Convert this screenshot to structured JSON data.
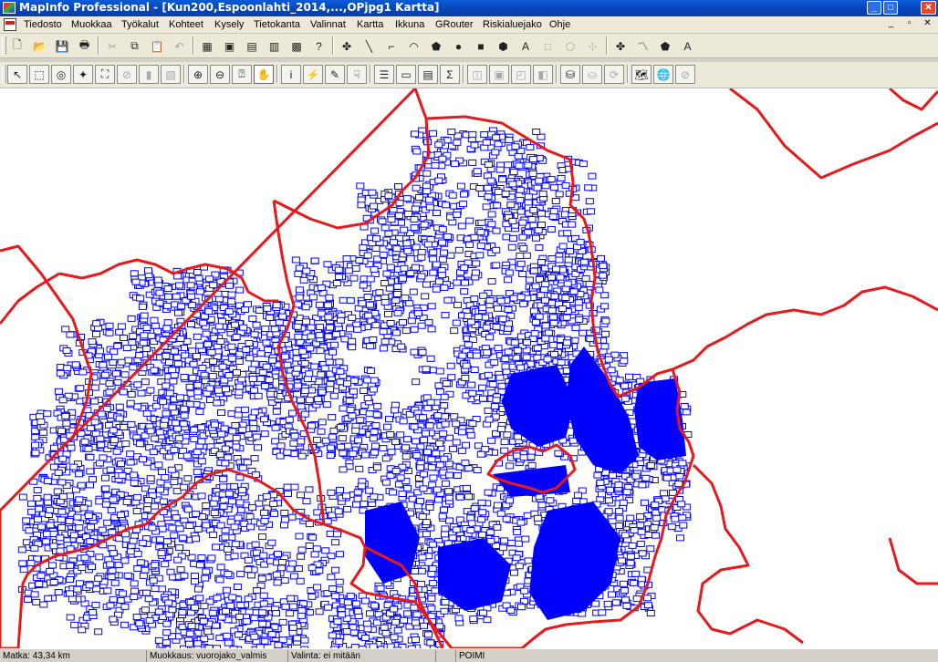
{
  "window": {
    "title": "MapInfo Professional - [Kun200,Espoonlahti_2014,...,OPjpg1 Kartta]",
    "controls": [
      "_",
      "□",
      "✕"
    ]
  },
  "menu": {
    "items": [
      "Tiedosto",
      "Muokkaa",
      "Työkalut",
      "Kohteet",
      "Kysely",
      "Tietokanta",
      "Valinnat",
      "Kartta",
      "Ikkuna",
      "GRouter",
      "Riskialuejako",
      "Ohje"
    ],
    "doc_controls": [
      "_",
      "▫",
      "✕"
    ]
  },
  "toolbar1": {
    "buttons": [
      {
        "name": "new-file-icon",
        "glyph": "🗋"
      },
      {
        "name": "open-folder-icon",
        "glyph": "📂"
      },
      {
        "name": "save-icon",
        "glyph": "💾",
        "disabled": true
      },
      {
        "name": "print-icon",
        "glyph": "🖶"
      },
      {
        "name": "cut-icon",
        "glyph": "✂",
        "disabled": true
      },
      {
        "name": "copy-icon",
        "glyph": "⧉"
      },
      {
        "name": "paste-icon",
        "glyph": "📋",
        "disabled": true
      },
      {
        "name": "undo-icon",
        "glyph": "↶",
        "disabled": true
      },
      {
        "name": "new-browser-icon",
        "glyph": "▦"
      },
      {
        "name": "new-map-icon",
        "glyph": "▣"
      },
      {
        "name": "new-graph-icon",
        "glyph": "▤"
      },
      {
        "name": "new-layout-icon",
        "glyph": "▥"
      },
      {
        "name": "new-redistrict-icon",
        "glyph": "▩"
      },
      {
        "name": "help-icon",
        "glyph": "?"
      },
      {
        "name": "symbol-tool-icon",
        "glyph": "✤"
      },
      {
        "name": "line-tool-icon",
        "glyph": "╲"
      },
      {
        "name": "polyline-tool-icon",
        "glyph": "⌐"
      },
      {
        "name": "arc-tool-icon",
        "glyph": "◠"
      },
      {
        "name": "polygon-tool-icon",
        "glyph": "⬟"
      },
      {
        "name": "ellipse-tool-icon",
        "glyph": "●"
      },
      {
        "name": "rectangle-tool-icon",
        "glyph": "■"
      },
      {
        "name": "rounded-rectangle-tool-icon",
        "glyph": "⬢"
      },
      {
        "name": "text-tool-icon",
        "glyph": "A"
      },
      {
        "name": "frame-tool-icon",
        "glyph": "□",
        "disabled": true
      },
      {
        "name": "reshape-tool-icon",
        "glyph": "⬠",
        "disabled": true
      },
      {
        "name": "add-node-tool-icon",
        "glyph": "⊹",
        "disabled": true
      },
      {
        "name": "symbol-style-icon",
        "glyph": "✤"
      },
      {
        "name": "line-style-icon",
        "glyph": "〽"
      },
      {
        "name": "region-style-icon",
        "glyph": "⬟"
      },
      {
        "name": "text-style-icon",
        "glyph": "A"
      }
    ]
  },
  "toolbar2": {
    "buttons": [
      {
        "name": "select-tool-icon",
        "glyph": "↖"
      },
      {
        "name": "marquee-select-icon",
        "glyph": "⬚"
      },
      {
        "name": "radius-select-icon",
        "glyph": "◎"
      },
      {
        "name": "polygon-select-icon",
        "glyph": "✦"
      },
      {
        "name": "boundary-select-icon",
        "glyph": "⛶"
      },
      {
        "name": "unselect-all-icon",
        "glyph": "⊘",
        "disabled": true
      },
      {
        "name": "invert-selection-icon",
        "glyph": "▮",
        "disabled": true
      },
      {
        "name": "graph-select-icon",
        "glyph": "▧",
        "disabled": true
      },
      {
        "name": "zoom-in-icon",
        "glyph": "⊕"
      },
      {
        "name": "zoom-out-icon",
        "glyph": "⊖"
      },
      {
        "name": "change-view-icon",
        "glyph": "⍰"
      },
      {
        "name": "grabber-hand-icon",
        "glyph": "✋",
        "active": true
      },
      {
        "name": "info-tool-icon",
        "glyph": "i"
      },
      {
        "name": "hotlink-icon",
        "glyph": "⚡",
        "disabled": true
      },
      {
        "name": "label-tool-icon",
        "glyph": "✎"
      },
      {
        "name": "drag-map-window-icon",
        "glyph": "☟"
      },
      {
        "name": "layer-control-icon",
        "glyph": "☰"
      },
      {
        "name": "ruler-icon",
        "glyph": "▭"
      },
      {
        "name": "show-legend-icon",
        "glyph": "▤"
      },
      {
        "name": "statistics-icon",
        "glyph": "Σ"
      },
      {
        "name": "clip-region-icon",
        "glyph": "◫",
        "disabled": true
      },
      {
        "name": "set-target-icon",
        "glyph": "▣",
        "disabled": true
      },
      {
        "name": "split-icon",
        "glyph": "◰",
        "disabled": true
      },
      {
        "name": "erase-icon",
        "glyph": "◧",
        "disabled": true
      },
      {
        "name": "database-open-icon",
        "glyph": "⛁"
      },
      {
        "name": "database-save-icon",
        "glyph": "⛀",
        "disabled": true
      },
      {
        "name": "database-refresh-icon",
        "glyph": "⟳",
        "disabled": true
      },
      {
        "name": "map-window-icon",
        "glyph": "🗺"
      },
      {
        "name": "globe-icon",
        "glyph": "🌐"
      },
      {
        "name": "disable-icon",
        "glyph": "⊘",
        "disabled": true
      }
    ]
  },
  "status": {
    "distance": "Matka: 43,34 km",
    "editing": "Muokkaus: vuorojako_valmis",
    "selection": "Valinta: ei mitään",
    "empty": "",
    "mode": "POIMI"
  },
  "colors": {
    "boundary": "#e41a1c",
    "points": "#0000ff",
    "map_background": "#ffffff"
  }
}
